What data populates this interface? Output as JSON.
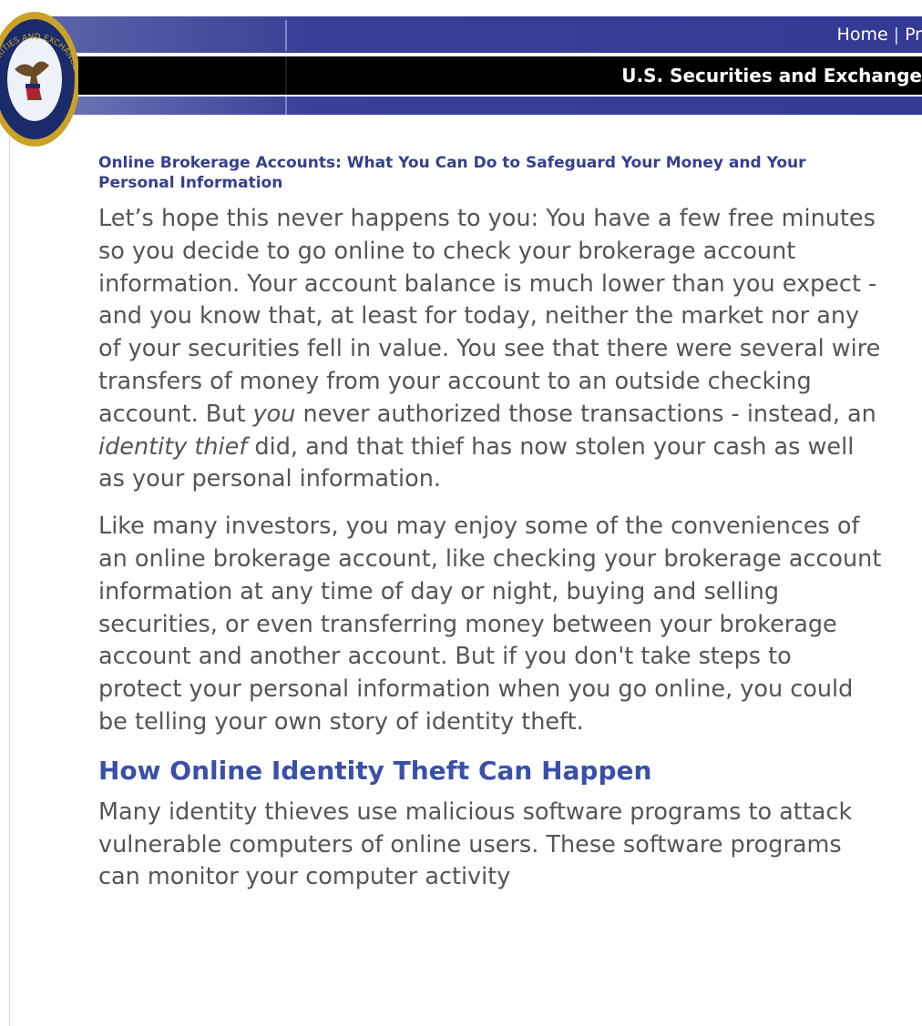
{
  "header": {
    "nav_home": "Home",
    "nav_separator": "|",
    "nav_partial": "Pr",
    "agency_name": "U.S. Securities and Exchange"
  },
  "seal": {
    "icon": "sec-seal-icon",
    "text": "SECURITIES AND EXCHANGE COMMISSION"
  },
  "article": {
    "title": "Online Brokerage Accounts: What You Can Do to Safeguard Your Money and Your Personal Information",
    "p1_a": "Let’s hope this never happens to you: You have a few free minutes so you decide to go online to check your brokerage account information.  Your account balance is much lower than you expect - and you know that, at least for today, neither the market nor any of your securities fell in value.  You see that there were several wire transfers of money from your account to an outside checking account.  But ",
    "p1_em1": "you",
    "p1_b": " never authorized those transactions - instead, an ",
    "p1_em2": "identity thief",
    "p1_c": " did, and that thief has now stolen your cash as well as your personal information.",
    "p2": "Like many investors, you may enjoy some of the conveniences of an online brokerage account, like checking your brokerage account information at any time of day or night, buying and selling securities, or even transferring money between your brokerage account and another account. But if you don't take steps to protect your personal information when you go online, you could be telling your own story of identity theft.",
    "section_heading": "How Online Identity Theft Can Happen",
    "p3": "Many identity thieves use malicious software programs to attack vulnerable computers of online users. These software programs can monitor your computer activity"
  },
  "colors": {
    "header_blue": "#343a93",
    "header_black": "#000000",
    "title_blue": "#34408f",
    "heading_blue": "#3a50a8",
    "body_text": "#555555",
    "seal_gold": "#c9a227",
    "seal_navy": "#1b2a6b"
  }
}
